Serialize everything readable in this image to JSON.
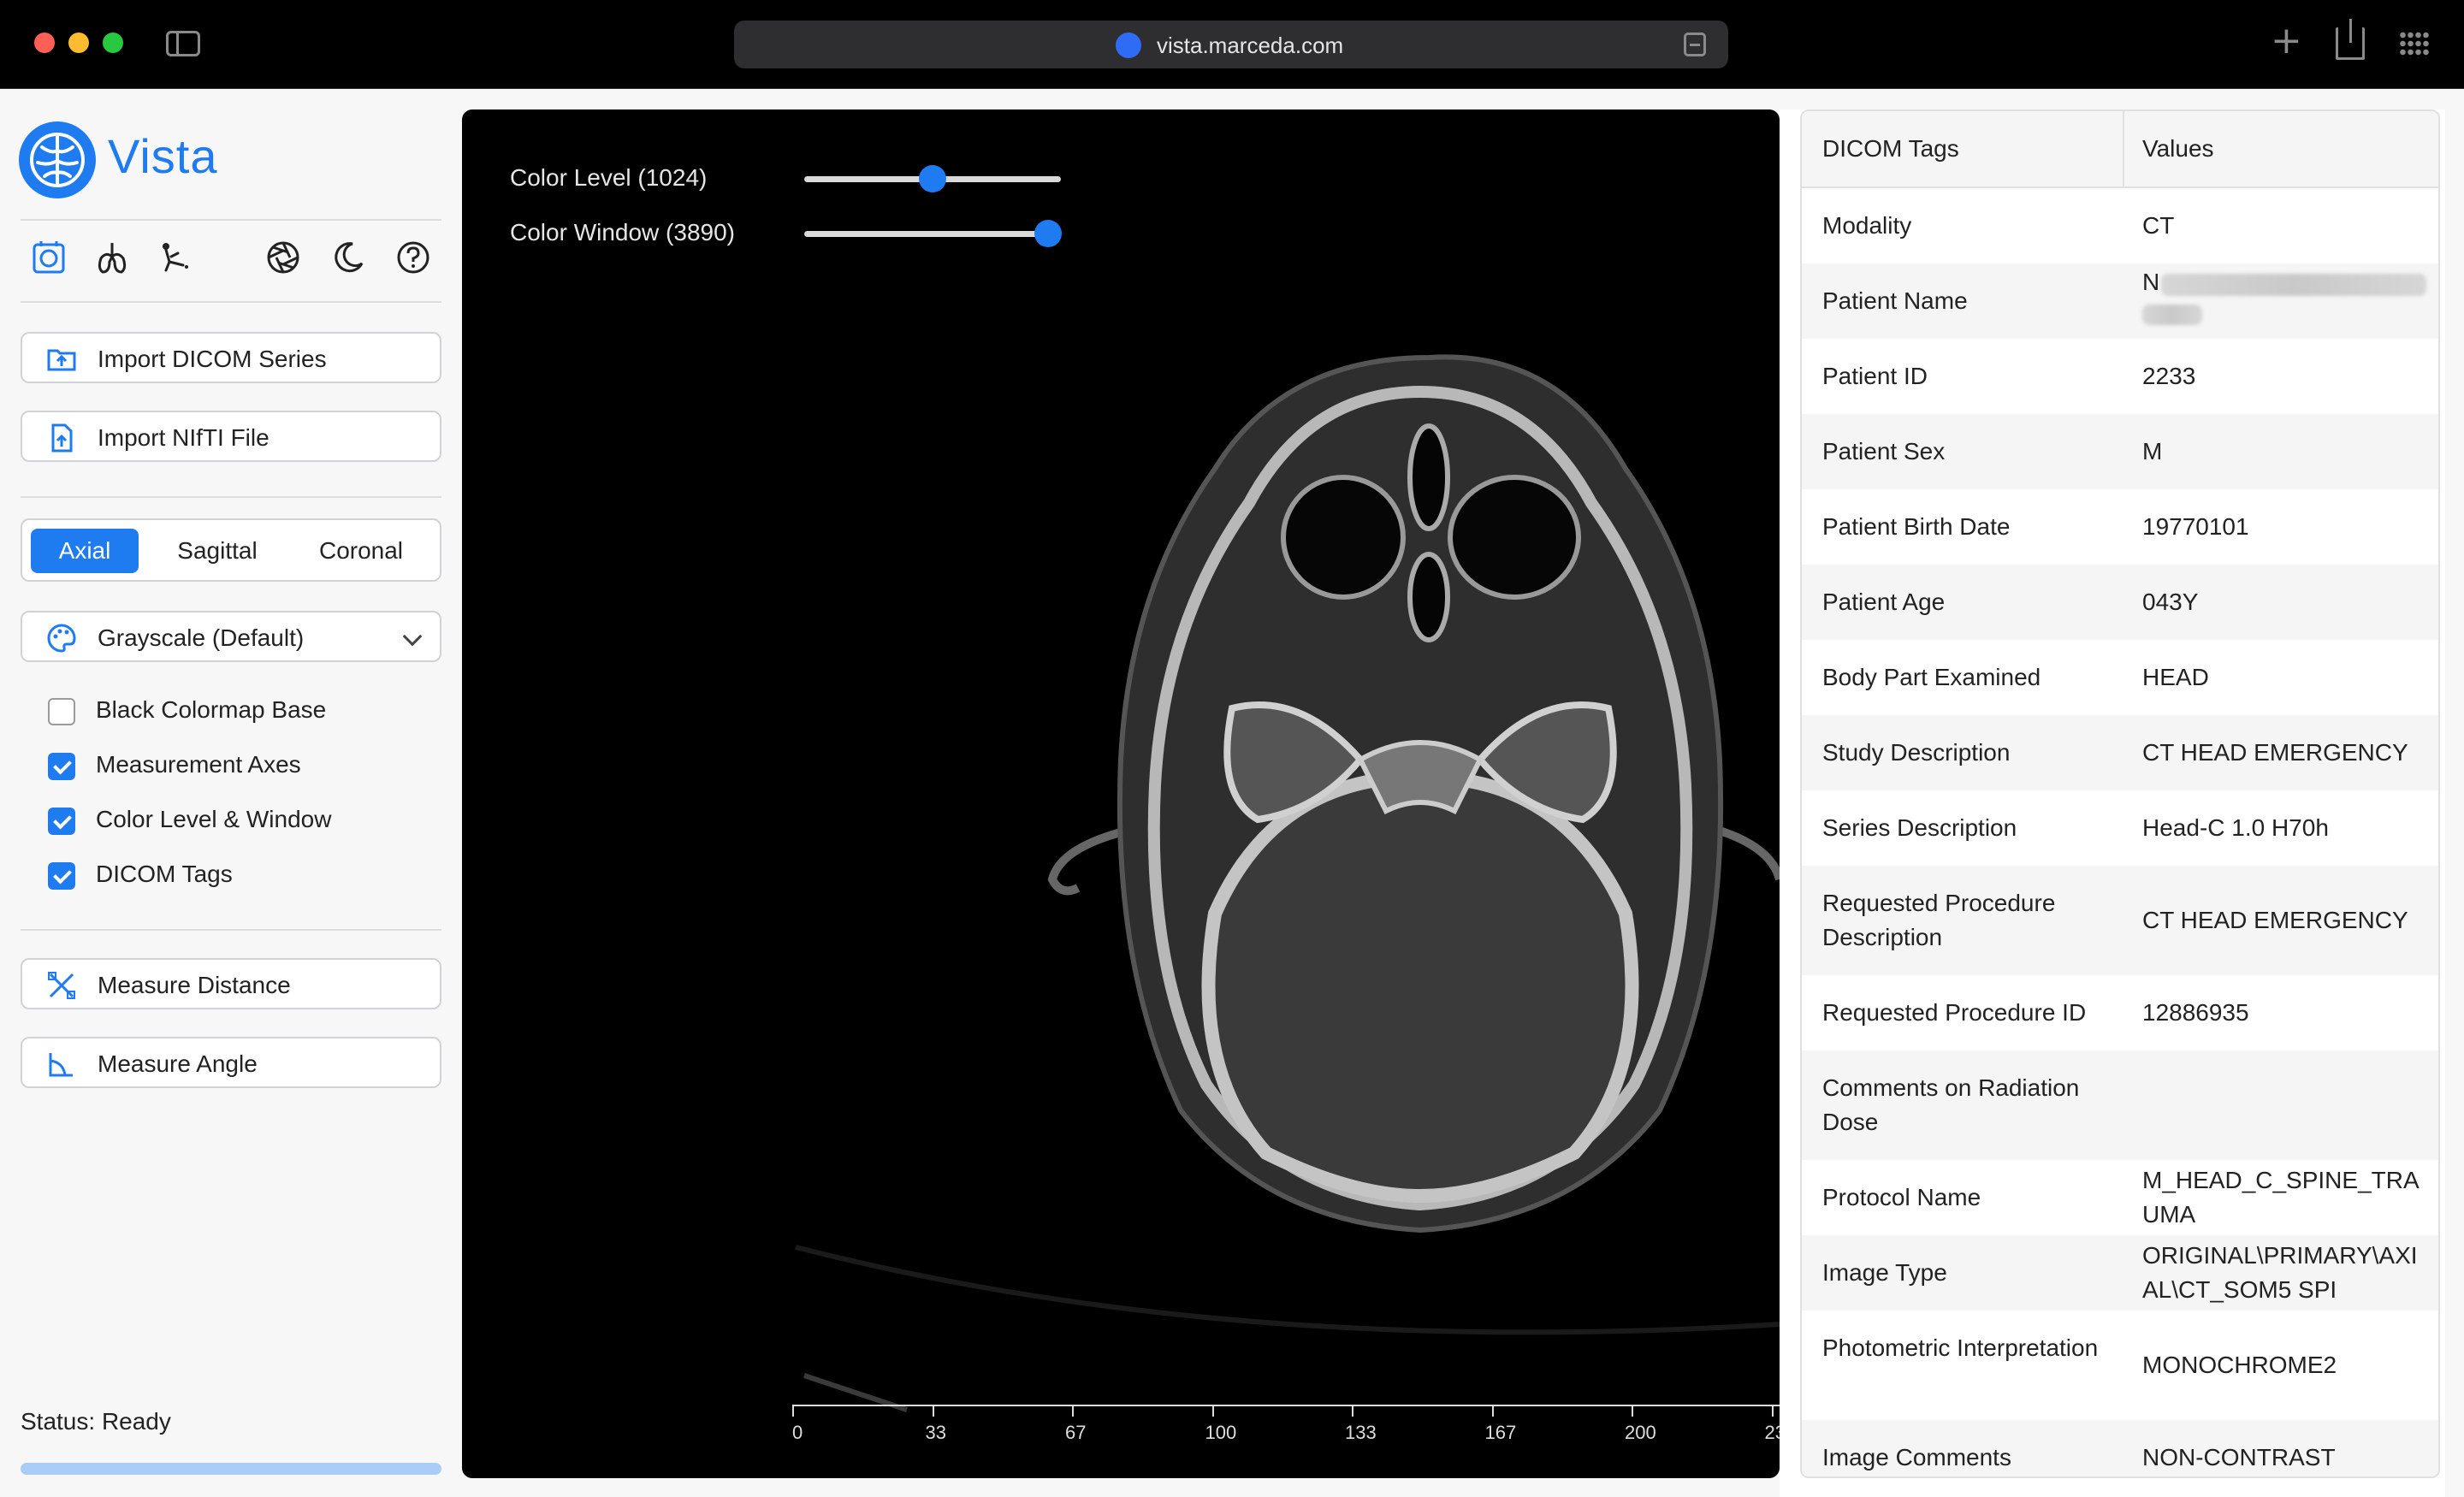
{
  "browser": {
    "url": "vista.marceda.com"
  },
  "app": {
    "name": "Vista"
  },
  "sidebar": {
    "import_dicom_label": "Import DICOM Series",
    "import_nifti_label": "Import NIfTI File",
    "views": [
      "Axial",
      "Sagittal",
      "Coronal"
    ],
    "active_view": "Axial",
    "colormap_selected": "Grayscale (Default)",
    "checkboxes": [
      {
        "label": "Black Colormap Base",
        "checked": false
      },
      {
        "label": "Measurement Axes",
        "checked": true
      },
      {
        "label": "Color Level & Window",
        "checked": true
      },
      {
        "label": "DICOM Tags",
        "checked": true
      }
    ],
    "measure_distance_label": "Measure Distance",
    "measure_angle_label": "Measure Angle",
    "status": "Status: Ready",
    "progress": 1.0
  },
  "viewer": {
    "color_level_label": "Color Level (1024)",
    "color_level_fraction": 0.5,
    "color_window_label": "Color Window (3890)",
    "color_window_fraction": 0.95,
    "axis_ticks": [
      "0",
      "33",
      "67",
      "100",
      "133",
      "167",
      "200",
      "23"
    ]
  },
  "dicom": {
    "header_key": "DICOM Tags",
    "header_value": "Values",
    "rows": [
      {
        "key": "Modality",
        "value": "CT"
      },
      {
        "key": "Patient Name",
        "value": "N"
      },
      {
        "key": "Patient ID",
        "value": "2233"
      },
      {
        "key": "Patient Sex",
        "value": "M"
      },
      {
        "key": "Patient Birth Date",
        "value": "19770101"
      },
      {
        "key": "Patient Age",
        "value": "043Y"
      },
      {
        "key": "Body Part Examined",
        "value": "HEAD"
      },
      {
        "key": "Study Description",
        "value": "CT HEAD EMERGENCY"
      },
      {
        "key": "Series Description",
        "value": "Head-C 1.0 H70h"
      },
      {
        "key": "Requested Procedure Description",
        "value": "CT HEAD EMERGENCY"
      },
      {
        "key": "Requested Procedure ID",
        "value": "12886935"
      },
      {
        "key": "Comments on Radiation Dose",
        "value": ""
      },
      {
        "key": "Protocol Name",
        "value": "M_HEAD_C_SPINE_TRAUMA"
      },
      {
        "key": "Image Type",
        "value": "ORIGINAL\\PRIMARY\\AXIAL\\CT_SOM5 SPI"
      },
      {
        "key": "Photometric Interpretation",
        "value": "MONOCHROME2"
      },
      {
        "key": "Image Comments",
        "value": "NON-CONTRAST"
      }
    ]
  },
  "colors": {
    "accent": "#1f7bf0",
    "viewer_bg": "#000000",
    "panel_bg": "#f7f7f8"
  }
}
